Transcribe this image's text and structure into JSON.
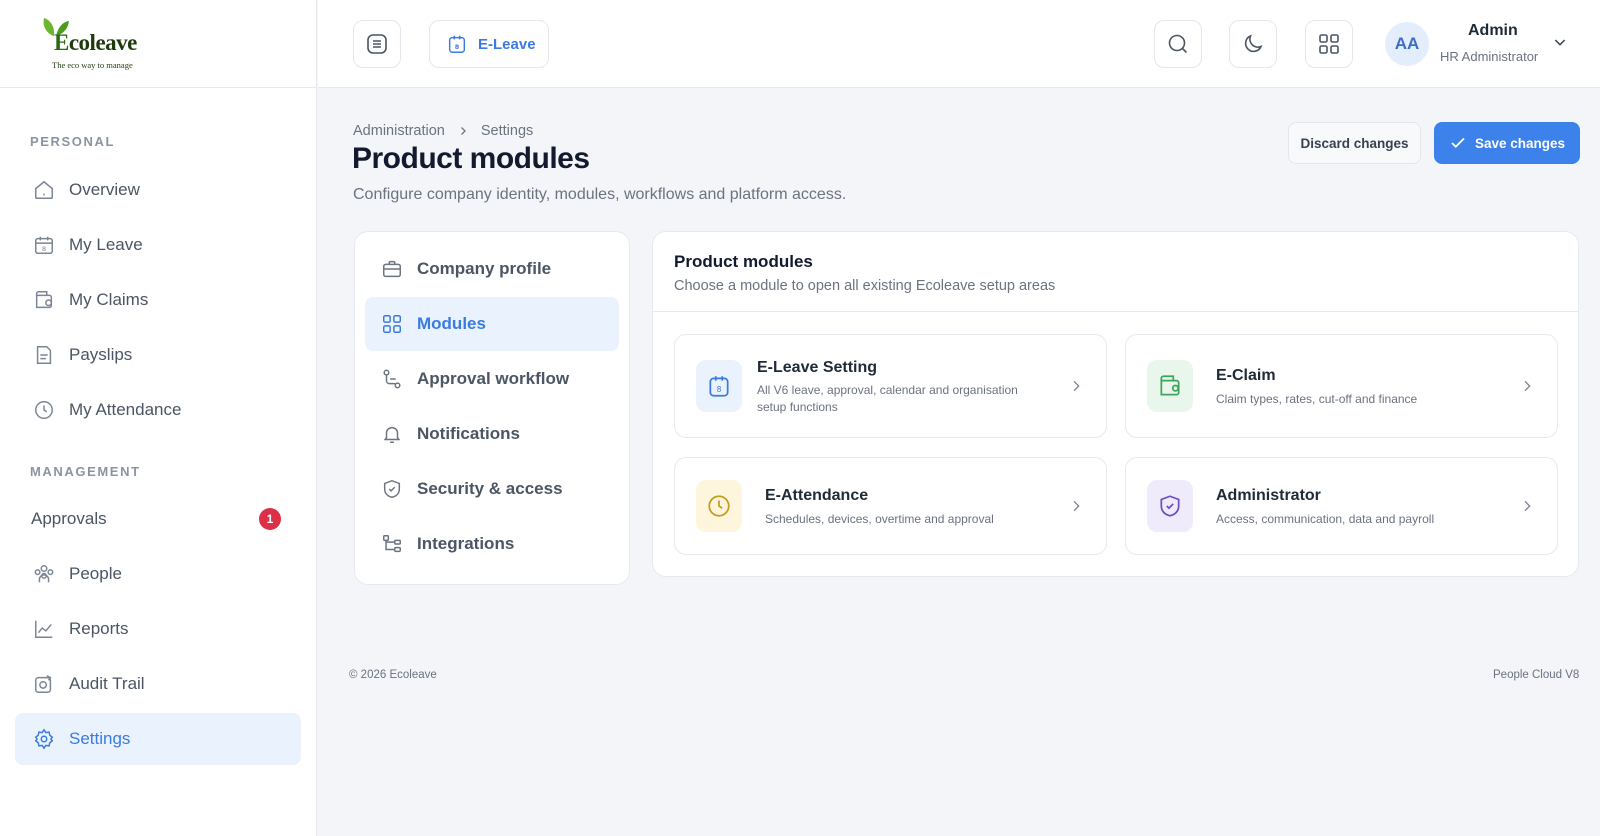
{
  "brand": {
    "logo_word": "Ecoleave",
    "logo_tagline": "The eco way to manage",
    "accent": "#3c82ea"
  },
  "sidebar": {
    "personal_label": "PERSONAL",
    "management_label": "MANAGEMENT",
    "items": [
      {
        "label": "Overview",
        "icon": "home-icon"
      },
      {
        "label": "My Leave",
        "icon": "calendar-icon"
      },
      {
        "label": "My Claims",
        "icon": "wallet-icon"
      },
      {
        "label": "Payslips",
        "icon": "document-icon"
      },
      {
        "label": "My Attendance",
        "icon": "clock-icon"
      },
      {
        "label": "Approvals",
        "badge": "1"
      },
      {
        "label": "People",
        "icon": "people-icon"
      },
      {
        "label": "Reports",
        "icon": "chart-icon"
      },
      {
        "label": "Audit Trail",
        "icon": "audit-icon"
      },
      {
        "label": "Settings",
        "icon": "gear-icon",
        "active": true
      }
    ]
  },
  "topbar": {
    "app_button": "E-Leave",
    "user": {
      "initials": "AA",
      "name": "Admin",
      "role": "HR Administrator"
    }
  },
  "breadcrumb": {
    "parent": "Administration",
    "current": "Settings"
  },
  "page": {
    "title": "Product modules",
    "subtitle": "Configure company identity, modules, workflows and platform access.",
    "discard_label": "Discard changes",
    "save_label": "Save changes"
  },
  "settings_menu": [
    {
      "label": "Company profile",
      "icon": "briefcase-icon"
    },
    {
      "label": "Modules",
      "icon": "grid-icon",
      "active": true
    },
    {
      "label": "Approval workflow",
      "icon": "workflow-icon"
    },
    {
      "label": "Notifications",
      "icon": "bell-icon"
    },
    {
      "label": "Security & access",
      "icon": "shield-icon"
    },
    {
      "label": "Integrations",
      "icon": "integration-icon"
    }
  ],
  "modules_panel": {
    "title": "Product modules",
    "subtitle": "Choose a module to open all existing Ecoleave setup areas",
    "modules": [
      {
        "title": "E-Leave Setting",
        "desc": "All V6 leave, approval, calendar and organisation setup functions",
        "icon": "calendar-icon",
        "color": "#3b7be0"
      },
      {
        "title": "E-Claim",
        "desc": "Claim types, rates, cut-off and finance",
        "icon": "wallet-icon",
        "color": "#3fa55b"
      },
      {
        "title": "E-Attendance",
        "desc": "Schedules, devices, overtime and approval",
        "icon": "clock-icon",
        "color": "#c89a1c"
      },
      {
        "title": "Administrator",
        "desc": "Access, communication, data and payroll",
        "icon": "shield-icon",
        "color": "#6a4fc7"
      }
    ]
  },
  "footer": {
    "copyright": "© 2026 Ecoleave",
    "version": "People Cloud V8"
  }
}
